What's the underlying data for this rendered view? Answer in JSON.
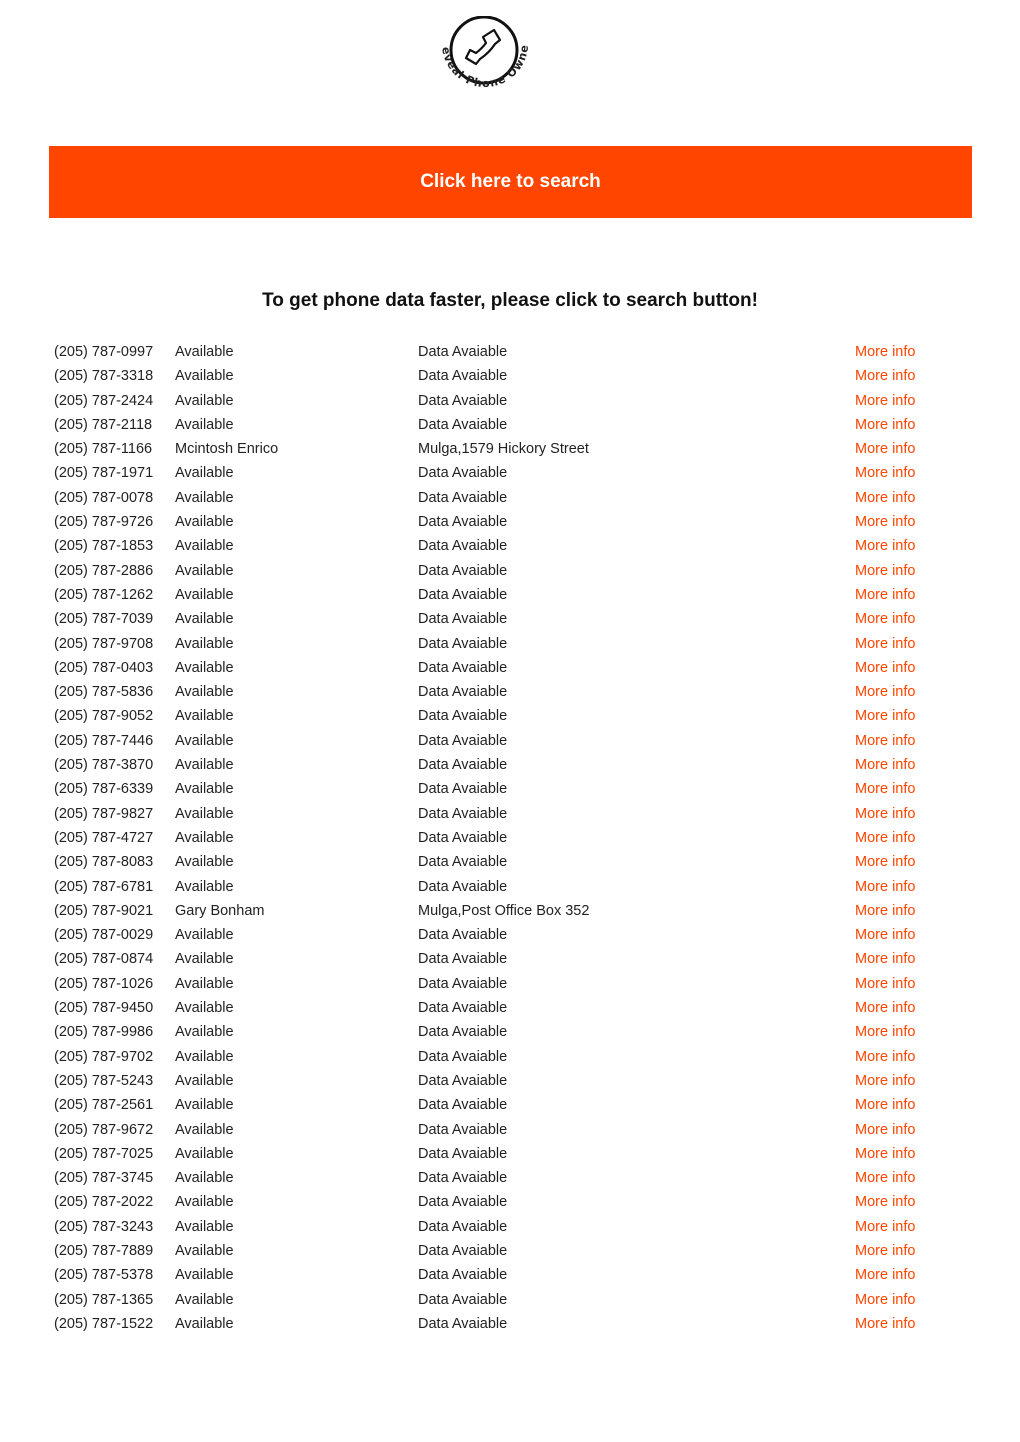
{
  "logo": {
    "text": "Reveal Phone Owner",
    "icon": "phone-handset-icon"
  },
  "search_button": {
    "label": "Click here to search",
    "color": "#ff4500"
  },
  "headline": "To get phone data faster, please click to search button!",
  "link_color": "#ff4500",
  "rows": [
    {
      "phone": "(205) 787-0997",
      "name": "Available",
      "address": "Data Avaiable",
      "link": "More info"
    },
    {
      "phone": "(205) 787-3318",
      "name": "Available",
      "address": "Data Avaiable",
      "link": "More info"
    },
    {
      "phone": "(205) 787-2424",
      "name": "Available",
      "address": "Data Avaiable",
      "link": "More info"
    },
    {
      "phone": "(205) 787-2118",
      "name": "Available",
      "address": "Data Avaiable",
      "link": "More info"
    },
    {
      "phone": "(205) 787-1166",
      "name": "Mcintosh Enrico",
      "address": "Mulga,1579 Hickory Street",
      "link": "More info"
    },
    {
      "phone": "(205) 787-1971",
      "name": "Available",
      "address": "Data Avaiable",
      "link": "More info"
    },
    {
      "phone": "(205) 787-0078",
      "name": "Available",
      "address": "Data Avaiable",
      "link": "More info"
    },
    {
      "phone": "(205) 787-9726",
      "name": "Available",
      "address": "Data Avaiable",
      "link": "More info"
    },
    {
      "phone": "(205) 787-1853",
      "name": "Available",
      "address": "Data Avaiable",
      "link": "More info"
    },
    {
      "phone": "(205) 787-2886",
      "name": "Available",
      "address": "Data Avaiable",
      "link": "More info"
    },
    {
      "phone": "(205) 787-1262",
      "name": "Available",
      "address": "Data Avaiable",
      "link": "More info"
    },
    {
      "phone": "(205) 787-7039",
      "name": "Available",
      "address": "Data Avaiable",
      "link": "More info"
    },
    {
      "phone": "(205) 787-9708",
      "name": "Available",
      "address": "Data Avaiable",
      "link": "More info"
    },
    {
      "phone": "(205) 787-0403",
      "name": "Available",
      "address": "Data Avaiable",
      "link": "More info"
    },
    {
      "phone": "(205) 787-5836",
      "name": "Available",
      "address": "Data Avaiable",
      "link": "More info"
    },
    {
      "phone": "(205) 787-9052",
      "name": "Available",
      "address": "Data Avaiable",
      "link": "More info"
    },
    {
      "phone": "(205) 787-7446",
      "name": "Available",
      "address": "Data Avaiable",
      "link": "More info"
    },
    {
      "phone": "(205) 787-3870",
      "name": "Available",
      "address": "Data Avaiable",
      "link": "More info"
    },
    {
      "phone": "(205) 787-6339",
      "name": "Available",
      "address": "Data Avaiable",
      "link": "More info"
    },
    {
      "phone": "(205) 787-9827",
      "name": "Available",
      "address": "Data Avaiable",
      "link": "More info"
    },
    {
      "phone": "(205) 787-4727",
      "name": "Available",
      "address": "Data Avaiable",
      "link": "More info"
    },
    {
      "phone": "(205) 787-8083",
      "name": "Available",
      "address": "Data Avaiable",
      "link": "More info"
    },
    {
      "phone": "(205) 787-6781",
      "name": "Available",
      "address": "Data Avaiable",
      "link": "More info"
    },
    {
      "phone": "(205) 787-9021",
      "name": "Gary Bonham",
      "address": "Mulga,Post Office Box 352",
      "link": "More info"
    },
    {
      "phone": "(205) 787-0029",
      "name": "Available",
      "address": "Data Avaiable",
      "link": "More info"
    },
    {
      "phone": "(205) 787-0874",
      "name": "Available",
      "address": "Data Avaiable",
      "link": "More info"
    },
    {
      "phone": "(205) 787-1026",
      "name": "Available",
      "address": "Data Avaiable",
      "link": "More info"
    },
    {
      "phone": "(205) 787-9450",
      "name": "Available",
      "address": "Data Avaiable",
      "link": "More info"
    },
    {
      "phone": "(205) 787-9986",
      "name": "Available",
      "address": "Data Avaiable",
      "link": "More info"
    },
    {
      "phone": "(205) 787-9702",
      "name": "Available",
      "address": "Data Avaiable",
      "link": "More info"
    },
    {
      "phone": "(205) 787-5243",
      "name": "Available",
      "address": "Data Avaiable",
      "link": "More info"
    },
    {
      "phone": "(205) 787-2561",
      "name": "Available",
      "address": "Data Avaiable",
      "link": "More info"
    },
    {
      "phone": "(205) 787-9672",
      "name": "Available",
      "address": "Data Avaiable",
      "link": "More info"
    },
    {
      "phone": "(205) 787-7025",
      "name": "Available",
      "address": "Data Avaiable",
      "link": "More info"
    },
    {
      "phone": "(205) 787-3745",
      "name": "Available",
      "address": "Data Avaiable",
      "link": "More info"
    },
    {
      "phone": "(205) 787-2022",
      "name": "Available",
      "address": "Data Avaiable",
      "link": "More info"
    },
    {
      "phone": "(205) 787-3243",
      "name": "Available",
      "address": "Data Avaiable",
      "link": "More info"
    },
    {
      "phone": "(205) 787-7889",
      "name": "Available",
      "address": "Data Avaiable",
      "link": "More info"
    },
    {
      "phone": "(205) 787-5378",
      "name": "Available",
      "address": "Data Avaiable",
      "link": "More info"
    },
    {
      "phone": "(205) 787-1365",
      "name": "Available",
      "address": "Data Avaiable",
      "link": "More info"
    },
    {
      "phone": "(205) 787-1522",
      "name": "Available",
      "address": "Data Avaiable",
      "link": "More info"
    }
  ]
}
